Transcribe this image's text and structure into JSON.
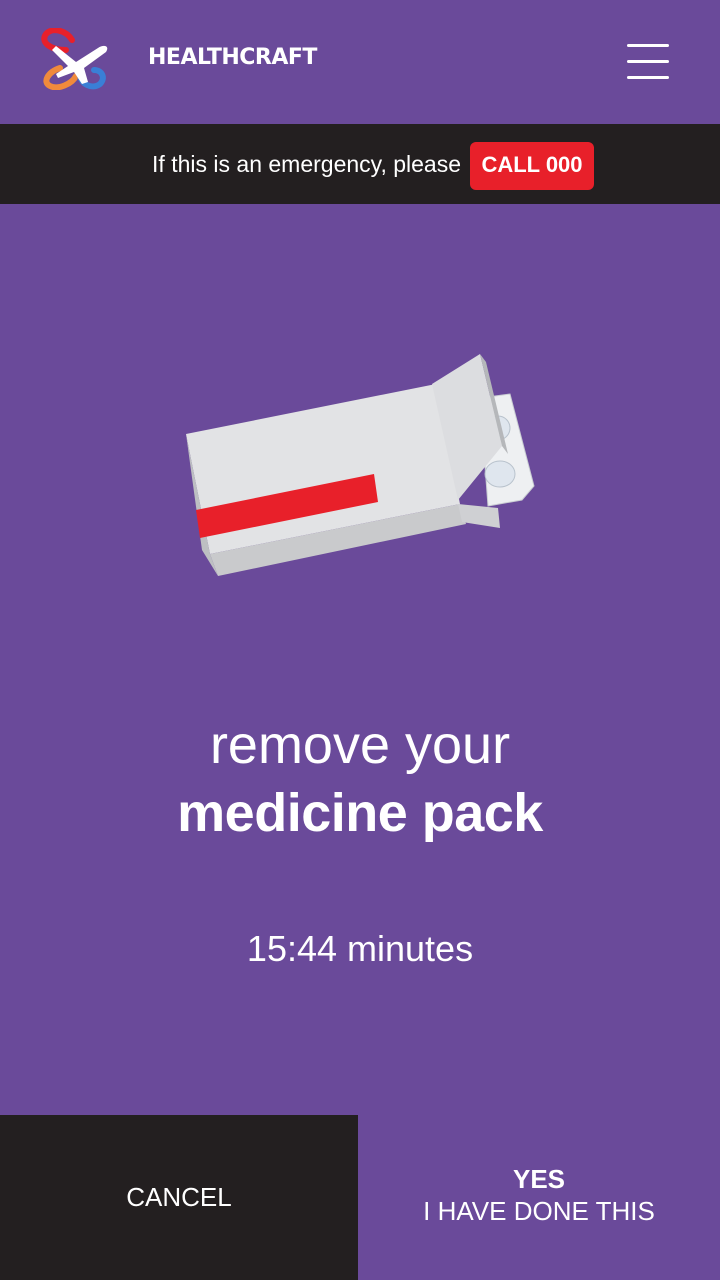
{
  "header": {
    "brand": "HEALTHCRAFT",
    "logo_icon": "healthcraft-logo-icon",
    "menu_icon": "hamburger-menu-icon"
  },
  "emergency": {
    "text": "If this is an emergency, please",
    "call_label": "CALL 000"
  },
  "illustration": {
    "icon": "medicine-pack-icon"
  },
  "instruction": {
    "line1": "remove your",
    "line2": "medicine pack"
  },
  "timer": {
    "text": "15:44 minutes"
  },
  "actions": {
    "cancel_label": "CANCEL",
    "confirm_line1": "YES",
    "confirm_line2": "I HAVE DONE THIS"
  },
  "colors": {
    "background": "#6a4a9a",
    "dark": "#231f20",
    "accent_red": "#e8202a",
    "text": "#ffffff"
  }
}
